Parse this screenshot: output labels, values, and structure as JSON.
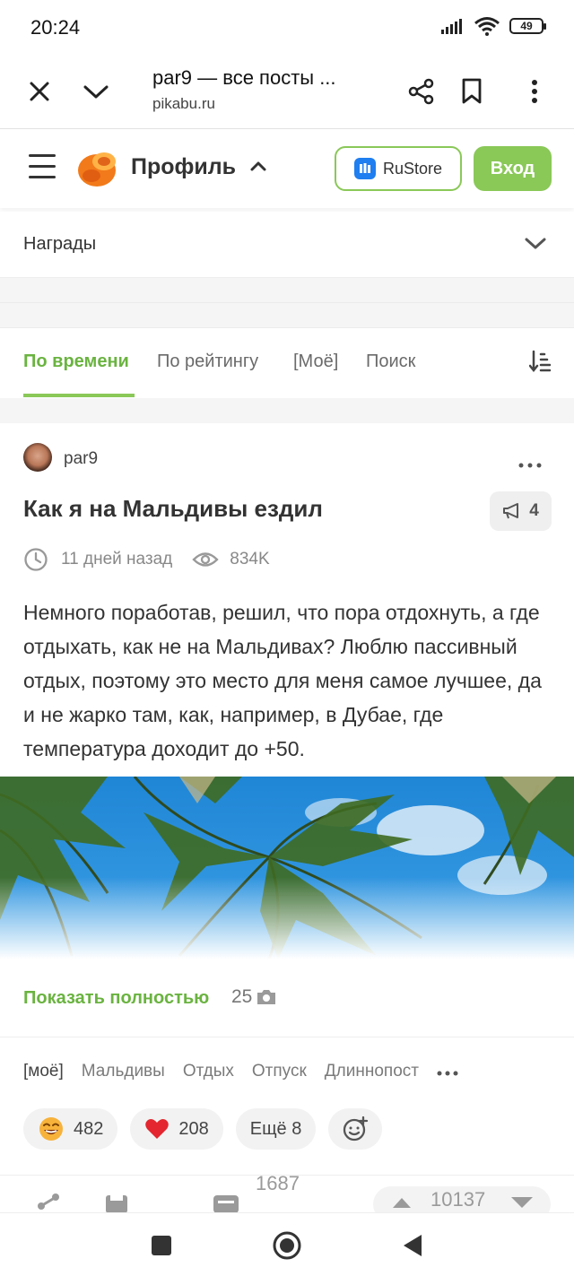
{
  "status_bar": {
    "time": "20:24",
    "battery": "49"
  },
  "browser": {
    "title": "par9 — все посты ...",
    "url": "pikabu.ru"
  },
  "site_header": {
    "profile_label": "Профиль",
    "rustore_label": "RuStore",
    "login_label": "Вход"
  },
  "awards": {
    "label": "Награды"
  },
  "tabs": [
    {
      "label": "По времени",
      "active": true
    },
    {
      "label": "По рейтингу",
      "active": false
    },
    {
      "label": "[Моё]",
      "active": false
    },
    {
      "label": "Поиск",
      "active": false
    }
  ],
  "post": {
    "author": "par9",
    "title": "Как я на Мальдивы ездил",
    "comments": "4",
    "time": "11 дней назад",
    "views": "834K",
    "text": "Немного поработав, решил, что пора отдохнуть, а где отдыхать, как не на Мальдивах? Люблю пассивный отдых, поэтому это место для меня самое лучшее, да и не жарко там, как, например, в Дубае, где температура доходит до +50.",
    "show_more": "Показать полностью",
    "photo_count": "25",
    "tags": [
      "[моё]",
      "Мальдивы",
      "Отдых",
      "Отпуск",
      "Длиннопост"
    ],
    "reactions": [
      {
        "icon": "laughing-face-icon",
        "count": "482"
      },
      {
        "icon": "heart-icon",
        "count": "208"
      }
    ],
    "more_reactions": "Ещё 8",
    "saves": "1687",
    "rating": "10137"
  },
  "colors": {
    "accent": "#8ac858",
    "accent_text": "#6ab340",
    "heart": "#e3262f",
    "rustore": "#1f7ef0"
  }
}
